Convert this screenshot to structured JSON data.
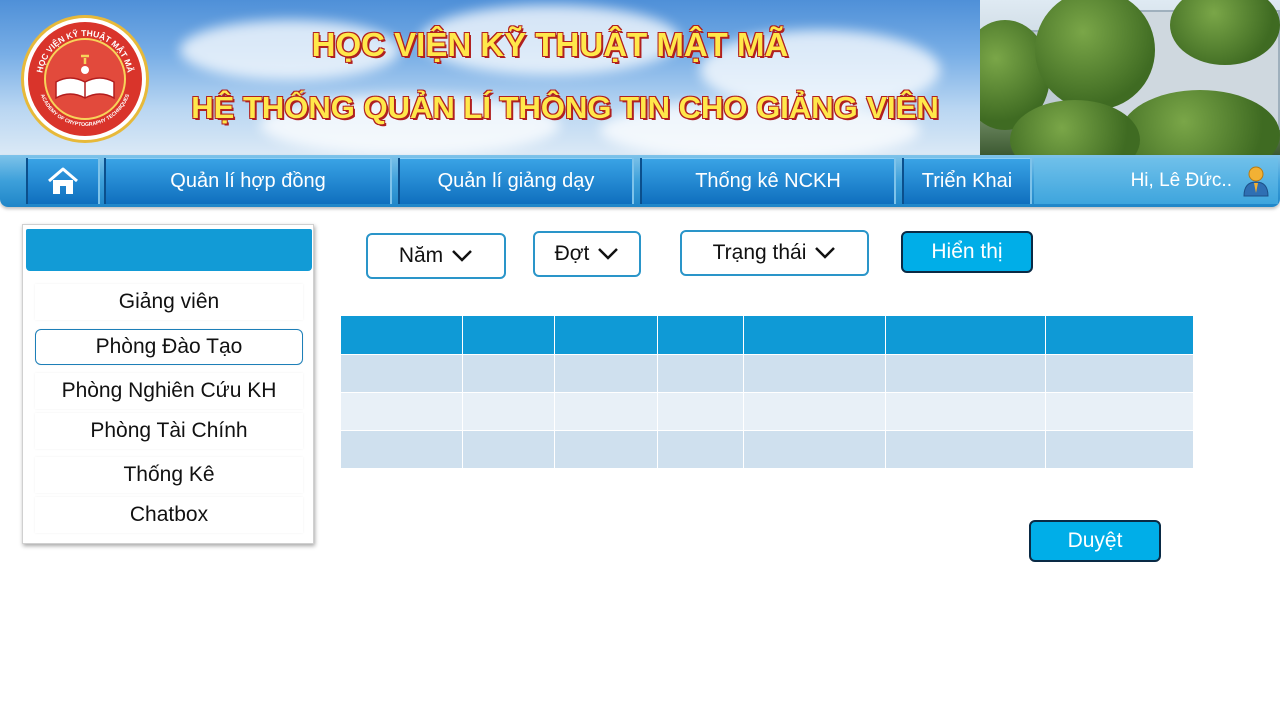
{
  "header": {
    "title": "HỌC VIỆN KỸ THUẬT MẬT MÃ",
    "subtitle": "HỆ THỐNG QUẢN LÍ THÔNG TIN CHO GIẢNG VIÊN",
    "logo_ring_text_top": "HỌC VIỆN KỸ THUẬT MẬT MÃ",
    "logo_ring_text_bottom": "ACADEMY OF CRYPTOGRAPHY TECHNIQUES"
  },
  "nav": {
    "items": [
      {
        "label": "Quản lí hợp đồng"
      },
      {
        "label": "Quản lí giảng dạy"
      },
      {
        "label": "Thống kê NCKH"
      },
      {
        "label": "Triển Khai"
      }
    ],
    "home_icon": "home-icon",
    "user_greeting": "Hi, Lê Đức..",
    "user_icon": "user-avatar-icon"
  },
  "sidebar": {
    "items": [
      {
        "label": "Giảng viên"
      },
      {
        "label": "Phòng Đào Tạo"
      },
      {
        "label": "Phòng Nghiên Cứu KH"
      },
      {
        "label": "Phòng Tài Chính"
      },
      {
        "label": "Thống Kê"
      },
      {
        "label": "Chatbox"
      }
    ],
    "active_item": "Phòng Đào Tạo"
  },
  "filters": {
    "year_label": "Năm",
    "term_label": "Đợt",
    "status_label": "Trạng thái",
    "show_button": "Hiển thị"
  },
  "actions": {
    "approve_button": "Duyệt"
  },
  "colors": {
    "accent": "#0f9ad6",
    "button": "#00aee8",
    "row_dark": "#cfe0ee",
    "row_light": "#e8f0f7",
    "title_yellow": "#ffe84a"
  }
}
